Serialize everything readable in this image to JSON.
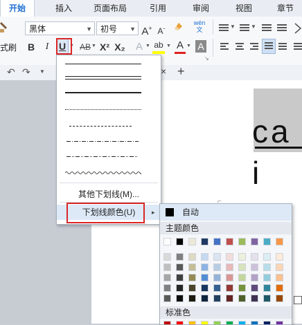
{
  "tabs": [
    "开始",
    "插入",
    "页面布局",
    "引用",
    "审阅",
    "视图",
    "章节"
  ],
  "ribbon": {
    "font_name": "黑体",
    "font_size": "初号",
    "grow_label": "A",
    "shrink_label": "A",
    "phonetic_label": "wén文",
    "format_painter_label": "式刷",
    "bold": "B",
    "italic": "I",
    "underline": "U",
    "strike": "AB",
    "superscript": "X²",
    "subscript": "X₂",
    "text_effect": "A",
    "highlight": "ab",
    "font_color": "A",
    "char_shading": "A"
  },
  "doc": {
    "close_glyph": "×",
    "add_glyph": "+",
    "body_text": "ca i"
  },
  "underline_menu": {
    "more_label": "其他下划线(M)...",
    "color_label": "下划线颜色(U)",
    "submenu_arrow": "▸"
  },
  "color_menu": {
    "auto_label": "自动",
    "theme_label": "主题颜色",
    "standard_label": "标准色",
    "theme_top": [
      "#ffffff",
      "#000000",
      "#ece9d8",
      "#1f3864",
      "#4472c4",
      "#c0504d",
      "#9bbb59",
      "#8064a2",
      "#4bacc6",
      "#f79646"
    ],
    "theme_shades": [
      [
        "#d9d9d9",
        "#808080",
        "#ddd9c3",
        "#c6d9f1",
        "#dbe5f1",
        "#f2dcdb",
        "#ebf1dd",
        "#e5e0ec",
        "#dbeef3",
        "#fdeada"
      ],
      [
        "#bfbfbf",
        "#595959",
        "#c4bd97",
        "#8db3e2",
        "#b8cce4",
        "#e6b9b8",
        "#d7e3bc",
        "#ccc1d9",
        "#b7dde8",
        "#fbd5b5"
      ],
      [
        "#a6a6a6",
        "#404040",
        "#948a54",
        "#548dd4",
        "#95b3d7",
        "#d99694",
        "#c3d69b",
        "#b2a2c7",
        "#93cddd",
        "#fac08f"
      ],
      [
        "#808080",
        "#262626",
        "#4a452a",
        "#17365d",
        "#366092",
        "#953734",
        "#76923c",
        "#5f497a",
        "#31859b",
        "#e36c09"
      ],
      [
        "#595959",
        "#0d0d0d",
        "#1d1b10",
        "#0f243e",
        "#244061",
        "#632423",
        "#4f6128",
        "#3f3151",
        "#205867",
        "#974806"
      ]
    ],
    "standard": [
      "#c00000",
      "#ff0000",
      "#ffc000",
      "#ffff00",
      "#92d050",
      "#00b050",
      "#00b0f0",
      "#0070c0",
      "#002060",
      "#7030a0"
    ]
  }
}
